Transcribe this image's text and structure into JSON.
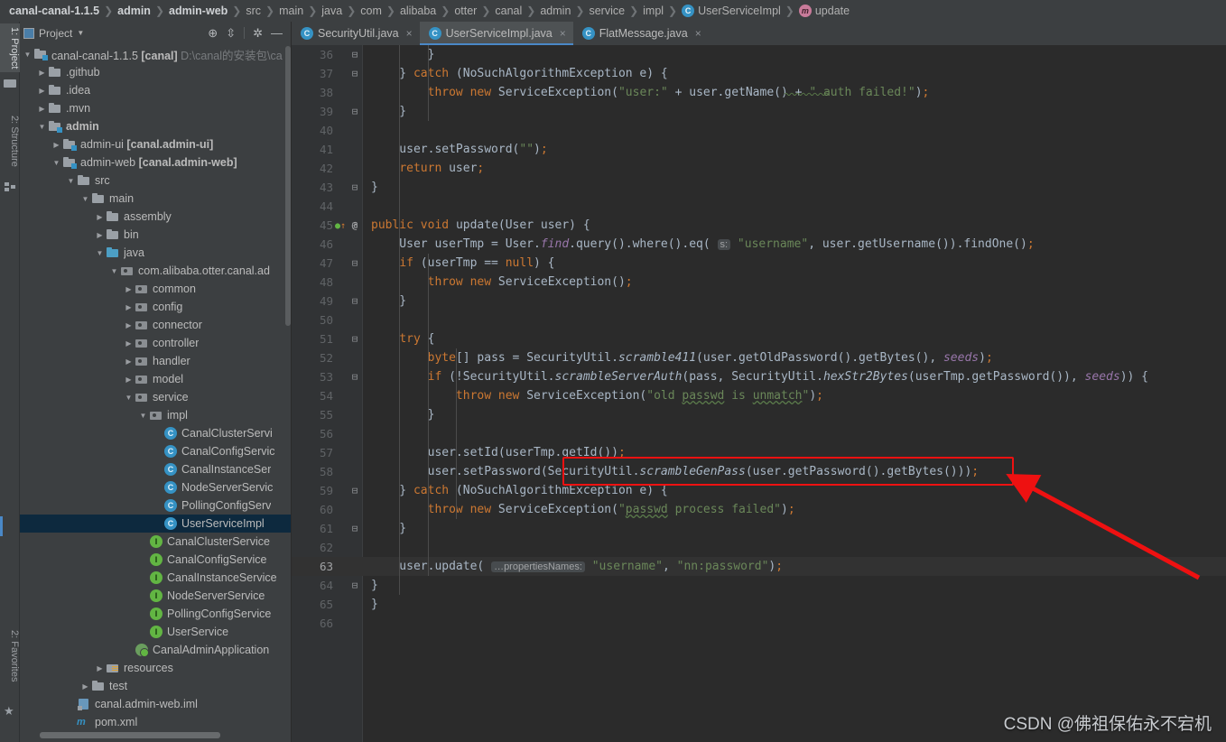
{
  "breadcrumb": [
    {
      "text": "canal-canal-1.1.5",
      "bold": true,
      "icon": null
    },
    {
      "text": "admin",
      "bold": true,
      "icon": null
    },
    {
      "text": "admin-web",
      "bold": true,
      "icon": null
    },
    {
      "text": "src",
      "bold": false,
      "icon": null
    },
    {
      "text": "main",
      "bold": false,
      "icon": null
    },
    {
      "text": "java",
      "bold": false,
      "icon": null
    },
    {
      "text": "com",
      "bold": false,
      "icon": null
    },
    {
      "text": "alibaba",
      "bold": false,
      "icon": null
    },
    {
      "text": "otter",
      "bold": false,
      "icon": null
    },
    {
      "text": "canal",
      "bold": false,
      "icon": null
    },
    {
      "text": "admin",
      "bold": false,
      "icon": null
    },
    {
      "text": "service",
      "bold": false,
      "icon": null
    },
    {
      "text": "impl",
      "bold": false,
      "icon": null
    },
    {
      "text": "UserServiceImpl",
      "bold": false,
      "icon": "class-icon"
    },
    {
      "text": "update",
      "bold": false,
      "icon": "method-icon"
    }
  ],
  "toolstrip": {
    "left_tabs": [
      {
        "label": "1: Project",
        "icon": "project-icon",
        "active": true
      },
      {
        "label": "2: Structure",
        "icon": "structure-icon",
        "active": false
      }
    ],
    "bottom_tabs": [
      {
        "label": "2: Favorites",
        "icon": "star-icon",
        "active": false
      }
    ]
  },
  "project_panel": {
    "title": "Project",
    "actions": [
      "locate-icon",
      "collapse-all-icon",
      "settings-icon",
      "hide-icon"
    ],
    "tree": [
      {
        "depth": 0,
        "arrow": "down",
        "icon": "module-icon",
        "label": "canal-canal-1.1.5",
        "bold_suffix": " [canal]",
        "dim_suffix": "  D:\\canal的安装包\\ca"
      },
      {
        "depth": 1,
        "arrow": "right",
        "icon": "folder-icon",
        "label": ".github"
      },
      {
        "depth": 1,
        "arrow": "right",
        "icon": "folder-icon",
        "label": ".idea"
      },
      {
        "depth": 1,
        "arrow": "right",
        "icon": "folder-icon",
        "label": ".mvn"
      },
      {
        "depth": 1,
        "arrow": "down",
        "icon": "module-icon",
        "label": "admin",
        "bold": true
      },
      {
        "depth": 2,
        "arrow": "right",
        "icon": "module-icon",
        "label": "admin-ui",
        "bold_suffix": " [canal.admin-ui]"
      },
      {
        "depth": 2,
        "arrow": "down",
        "icon": "module-icon",
        "label": "admin-web",
        "bold_suffix": " [canal.admin-web]"
      },
      {
        "depth": 3,
        "arrow": "down",
        "icon": "folder-icon",
        "label": "src"
      },
      {
        "depth": 4,
        "arrow": "down",
        "icon": "folder-icon",
        "label": "main"
      },
      {
        "depth": 5,
        "arrow": "right",
        "icon": "folder-icon",
        "label": "assembly"
      },
      {
        "depth": 5,
        "arrow": "right",
        "icon": "folder-icon",
        "label": "bin"
      },
      {
        "depth": 5,
        "arrow": "down",
        "icon": "source-folder-icon",
        "label": "java"
      },
      {
        "depth": 6,
        "arrow": "down",
        "icon": "package-icon",
        "label": "com.alibaba.otter.canal.ad"
      },
      {
        "depth": 7,
        "arrow": "right",
        "icon": "package-icon",
        "label": "common"
      },
      {
        "depth": 7,
        "arrow": "right",
        "icon": "package-icon",
        "label": "config"
      },
      {
        "depth": 7,
        "arrow": "right",
        "icon": "package-icon",
        "label": "connector"
      },
      {
        "depth": 7,
        "arrow": "right",
        "icon": "package-icon",
        "label": "controller"
      },
      {
        "depth": 7,
        "arrow": "right",
        "icon": "package-icon",
        "label": "handler"
      },
      {
        "depth": 7,
        "arrow": "right",
        "icon": "package-icon",
        "label": "model"
      },
      {
        "depth": 7,
        "arrow": "down",
        "icon": "package-icon",
        "label": "service"
      },
      {
        "depth": 8,
        "arrow": "down",
        "icon": "package-icon",
        "label": "impl"
      },
      {
        "depth": 9,
        "arrow": "none",
        "icon": "class-icon",
        "label": "CanalClusterServi"
      },
      {
        "depth": 9,
        "arrow": "none",
        "icon": "class-icon",
        "label": "CanalConfigServic"
      },
      {
        "depth": 9,
        "arrow": "none",
        "icon": "class-icon",
        "label": "CanalInstanceSer"
      },
      {
        "depth": 9,
        "arrow": "none",
        "icon": "class-icon",
        "label": "NodeServerServic"
      },
      {
        "depth": 9,
        "arrow": "none",
        "icon": "class-icon",
        "label": "PollingConfigServ"
      },
      {
        "depth": 9,
        "arrow": "none",
        "icon": "class-icon",
        "label": "UserServiceImpl",
        "selected": true
      },
      {
        "depth": 8,
        "arrow": "none",
        "icon": "interface-icon",
        "label": "CanalClusterService"
      },
      {
        "depth": 8,
        "arrow": "none",
        "icon": "interface-icon",
        "label": "CanalConfigService"
      },
      {
        "depth": 8,
        "arrow": "none",
        "icon": "interface-icon",
        "label": "CanalInstanceService"
      },
      {
        "depth": 8,
        "arrow": "none",
        "icon": "interface-icon",
        "label": "NodeServerService"
      },
      {
        "depth": 8,
        "arrow": "none",
        "icon": "interface-icon",
        "label": "PollingConfigService"
      },
      {
        "depth": 8,
        "arrow": "none",
        "icon": "interface-icon",
        "label": "UserService"
      },
      {
        "depth": 7,
        "arrow": "none",
        "icon": "spring-icon",
        "label": "CanalAdminApplication"
      },
      {
        "depth": 5,
        "arrow": "right",
        "icon": "resources-folder-icon",
        "label": "resources"
      },
      {
        "depth": 4,
        "arrow": "right",
        "icon": "folder-icon",
        "label": "test"
      },
      {
        "depth": 3,
        "arrow": "none",
        "icon": "iml-icon",
        "label": "canal.admin-web.iml"
      },
      {
        "depth": 3,
        "arrow": "none",
        "icon": "maven-icon",
        "label": "pom.xml"
      }
    ]
  },
  "editor": {
    "tabs": [
      {
        "label": "SecurityUtil.java",
        "icon": "class-icon",
        "active": false,
        "close": "×"
      },
      {
        "label": "UserServiceImpl.java",
        "icon": "class-icon",
        "active": true,
        "close": "×"
      },
      {
        "label": "FlatMessage.java",
        "icon": "class-icon",
        "active": false,
        "close": "×"
      }
    ],
    "first_line_number": 36,
    "current_line": 63,
    "lines": [
      {
        "n": 36,
        "fold": "minus",
        "indent": 3,
        "tokens": [
          {
            "t": "        }",
            "c": "punc"
          }
        ]
      },
      {
        "n": 37,
        "fold": "minus",
        "indent": 2,
        "tokens": [
          {
            "t": "    } ",
            "c": "punc"
          },
          {
            "t": "catch",
            "c": "kw"
          },
          {
            "t": " (NoSuchAlgorithmException e) {",
            "c": "punc"
          }
        ]
      },
      {
        "n": 38,
        "fold": "",
        "indent": 3,
        "tokens": [
          {
            "t": "        ",
            "c": "punc"
          },
          {
            "t": "throw",
            "c": "kw"
          },
          {
            "t": " ",
            "c": "punc"
          },
          {
            "t": "new",
            "c": "kw"
          },
          {
            "t": " ServiceException(",
            "c": "punc"
          },
          {
            "t": "\"user:\"",
            "c": "str"
          },
          {
            "t": " + user.getName() + ",
            "c": "punc"
          },
          {
            "t": "\" auth failed!\"",
            "c": "str"
          },
          {
            "t": ")",
            "c": "punc"
          },
          {
            "t": ";",
            "c": "semi"
          }
        ]
      },
      {
        "n": 39,
        "fold": "minus",
        "indent": 2,
        "tokens": [
          {
            "t": "    }",
            "c": "punc"
          }
        ]
      },
      {
        "n": 40,
        "fold": "",
        "indent": 2,
        "tokens": []
      },
      {
        "n": 41,
        "fold": "",
        "indent": 2,
        "tokens": [
          {
            "t": "    user.setPassword(",
            "c": "punc"
          },
          {
            "t": "\"\"",
            "c": "str"
          },
          {
            "t": ")",
            "c": "punc"
          },
          {
            "t": ";",
            "c": "semi"
          }
        ]
      },
      {
        "n": 42,
        "fold": "",
        "indent": 2,
        "tokens": [
          {
            "t": "    ",
            "c": "punc"
          },
          {
            "t": "return",
            "c": "kw"
          },
          {
            "t": " user",
            "c": "punc"
          },
          {
            "t": ";",
            "c": "semi"
          }
        ]
      },
      {
        "n": 43,
        "fold": "minus",
        "indent": 1,
        "tokens": [
          {
            "t": "}",
            "c": "punc"
          }
        ]
      },
      {
        "n": 44,
        "fold": "",
        "indent": 1,
        "tokens": []
      },
      {
        "n": 45,
        "fold": "minus",
        "indent": 1,
        "gutter": "override-annotation",
        "tokens": [
          {
            "t": "public",
            "c": "kw"
          },
          {
            "t": " ",
            "c": "punc"
          },
          {
            "t": "void",
            "c": "kw"
          },
          {
            "t": " ",
            "c": "punc"
          },
          {
            "t": "update",
            "c": "cls2"
          },
          {
            "t": "(User user) {",
            "c": "punc"
          }
        ]
      },
      {
        "n": 46,
        "fold": "",
        "indent": 2,
        "tokens": [
          {
            "t": "    User userTmp = User.",
            "c": "punc"
          },
          {
            "t": "find",
            "c": "fld"
          },
          {
            "t": ".query().where().eq( ",
            "c": "punc"
          },
          {
            "t": "s:",
            "c": "hint"
          },
          {
            "t": " ",
            "c": "punc"
          },
          {
            "t": "\"username\"",
            "c": "str"
          },
          {
            "t": ", user.getUsername()).findOne()",
            "c": "punc"
          },
          {
            "t": ";",
            "c": "semi"
          }
        ]
      },
      {
        "n": 47,
        "fold": "minus",
        "indent": 2,
        "tokens": [
          {
            "t": "    ",
            "c": "punc"
          },
          {
            "t": "if",
            "c": "kw"
          },
          {
            "t": " (userTmp == ",
            "c": "punc"
          },
          {
            "t": "null",
            "c": "kw"
          },
          {
            "t": ") {",
            "c": "punc"
          }
        ]
      },
      {
        "n": 48,
        "fold": "",
        "indent": 3,
        "tokens": [
          {
            "t": "        ",
            "c": "punc"
          },
          {
            "t": "throw",
            "c": "kw"
          },
          {
            "t": " ",
            "c": "punc"
          },
          {
            "t": "new",
            "c": "kw"
          },
          {
            "t": " ServiceException()",
            "c": "punc"
          },
          {
            "t": ";",
            "c": "semi"
          }
        ]
      },
      {
        "n": 49,
        "fold": "minus",
        "indent": 2,
        "tokens": [
          {
            "t": "    }",
            "c": "punc"
          }
        ]
      },
      {
        "n": 50,
        "fold": "",
        "indent": 2,
        "tokens": []
      },
      {
        "n": 51,
        "fold": "minus",
        "indent": 2,
        "tokens": [
          {
            "t": "    ",
            "c": "punc"
          },
          {
            "t": "try",
            "c": "kw"
          },
          {
            "t": " {",
            "c": "punc"
          }
        ]
      },
      {
        "n": 52,
        "fold": "",
        "indent": 3,
        "tokens": [
          {
            "t": "        ",
            "c": "punc"
          },
          {
            "t": "byte",
            "c": "kw"
          },
          {
            "t": "[] pass = SecurityUtil.",
            "c": "punc"
          },
          {
            "t": "scramble411",
            "c": "mth"
          },
          {
            "t": "(user.getOldPassword().getBytes(), ",
            "c": "punc"
          },
          {
            "t": "seeds",
            "c": "fld"
          },
          {
            "t": ")",
            "c": "punc"
          },
          {
            "t": ";",
            "c": "semi"
          }
        ]
      },
      {
        "n": 53,
        "fold": "minus",
        "indent": 3,
        "tokens": [
          {
            "t": "        ",
            "c": "punc"
          },
          {
            "t": "if",
            "c": "kw"
          },
          {
            "t": " (!SecurityUtil.",
            "c": "punc"
          },
          {
            "t": "scrambleServerAuth",
            "c": "mth"
          },
          {
            "t": "(pass, SecurityUtil.",
            "c": "punc"
          },
          {
            "t": "hexStr2Bytes",
            "c": "mth"
          },
          {
            "t": "(userTmp.getPassword()), ",
            "c": "punc"
          },
          {
            "t": "seeds",
            "c": "fld"
          },
          {
            "t": ")) {",
            "c": "punc"
          }
        ]
      },
      {
        "n": 54,
        "fold": "",
        "indent": 4,
        "tokens": [
          {
            "t": "            ",
            "c": "punc"
          },
          {
            "t": "throw",
            "c": "kw"
          },
          {
            "t": " ",
            "c": "punc"
          },
          {
            "t": "new",
            "c": "kw"
          },
          {
            "t": " ServiceException(",
            "c": "punc"
          },
          {
            "t": "\"old ",
            "c": "str"
          },
          {
            "t": "passwd",
            "c": "str warnwave"
          },
          {
            "t": " is ",
            "c": "str"
          },
          {
            "t": "unmatch",
            "c": "str warnwave"
          },
          {
            "t": "\"",
            "c": "str"
          },
          {
            "t": ")",
            "c": "punc"
          },
          {
            "t": ";",
            "c": "semi"
          }
        ]
      },
      {
        "n": 55,
        "fold": "",
        "indent": 3,
        "tokens": [
          {
            "t": "        }",
            "c": "punc"
          }
        ]
      },
      {
        "n": 56,
        "fold": "",
        "indent": 3,
        "tokens": []
      },
      {
        "n": 57,
        "fold": "",
        "indent": 3,
        "tokens": [
          {
            "t": "        user.setId(userTmp.getId())",
            "c": "punc"
          },
          {
            "t": ";",
            "c": "semi"
          }
        ]
      },
      {
        "n": 58,
        "fold": "",
        "indent": 3,
        "tokens": [
          {
            "t": "        user.setPassword(SecurityUtil.",
            "c": "punc"
          },
          {
            "t": "scrambleGenPass",
            "c": "mth"
          },
          {
            "t": "(user.getPassword().getBytes()))",
            "c": "punc"
          },
          {
            "t": ";",
            "c": "semi"
          }
        ]
      },
      {
        "n": 59,
        "fold": "minus",
        "indent": 2,
        "tokens": [
          {
            "t": "    } ",
            "c": "punc"
          },
          {
            "t": "catch",
            "c": "kw"
          },
          {
            "t": " (NoSuchAlgorithmException e) {",
            "c": "punc"
          }
        ]
      },
      {
        "n": 60,
        "fold": "",
        "indent": 3,
        "tokens": [
          {
            "t": "        ",
            "c": "punc"
          },
          {
            "t": "throw",
            "c": "kw"
          },
          {
            "t": " ",
            "c": "punc"
          },
          {
            "t": "new",
            "c": "kw"
          },
          {
            "t": " ServiceException(",
            "c": "punc"
          },
          {
            "t": "\"",
            "c": "str"
          },
          {
            "t": "passwd",
            "c": "str warnwave"
          },
          {
            "t": " process failed\"",
            "c": "str"
          },
          {
            "t": ")",
            "c": "punc"
          },
          {
            "t": ";",
            "c": "semi"
          }
        ]
      },
      {
        "n": 61,
        "fold": "minus",
        "indent": 2,
        "tokens": [
          {
            "t": "    }",
            "c": "punc"
          }
        ]
      },
      {
        "n": 62,
        "fold": "",
        "indent": 2,
        "tokens": []
      },
      {
        "n": 63,
        "fold": "",
        "indent": 2,
        "current": true,
        "tokens": [
          {
            "t": "    user.update( ",
            "c": "punc"
          },
          {
            "t": "…propertiesNames:",
            "c": "hint"
          },
          {
            "t": " ",
            "c": "punc"
          },
          {
            "t": "\"username\"",
            "c": "str"
          },
          {
            "t": ", ",
            "c": "punc"
          },
          {
            "t": "\"nn:password\"",
            "c": "str"
          },
          {
            "t": ")",
            "c": "punc"
          },
          {
            "t": ";",
            "c": "semi"
          }
        ]
      },
      {
        "n": 64,
        "fold": "minus",
        "indent": 1,
        "tokens": [
          {
            "t": "}",
            "c": "punc"
          }
        ]
      },
      {
        "n": 65,
        "fold": "",
        "indent": 0,
        "tokens": [
          {
            "t": "}",
            "c": "punc"
          }
        ]
      },
      {
        "n": 66,
        "fold": "",
        "indent": 0,
        "tokens": []
      }
    ]
  },
  "annotation": {
    "highlight_line": 58,
    "highlight_color": "#ee1111",
    "arrow_color": "#ee1111"
  },
  "watermark": "CSDN @佛祖保佑永不宕机"
}
